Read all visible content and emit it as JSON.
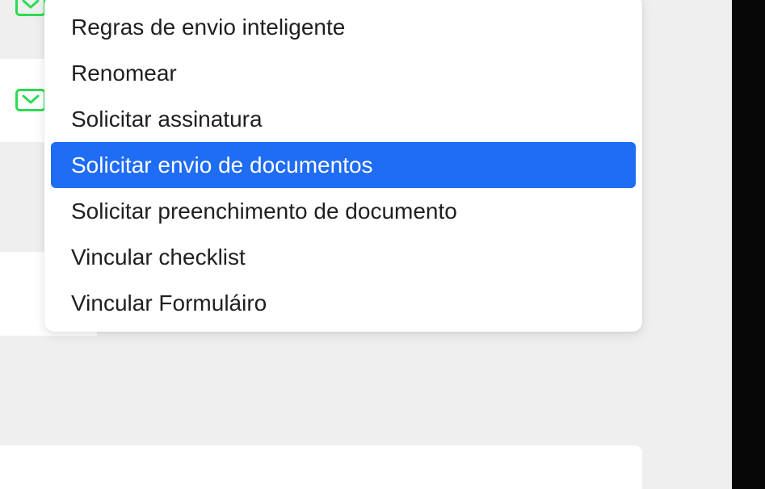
{
  "theme": {
    "selected_color": "#1f6cf5",
    "icon_color": "#2bdc52",
    "background_color": "#efefef",
    "edge_color": "#070707"
  },
  "background": {
    "icons": [
      "mail-icon",
      "mail-icon"
    ]
  },
  "menu": {
    "items": [
      {
        "label": "Regras de envio inteligente",
        "selected": false
      },
      {
        "label": "Renomear",
        "selected": false
      },
      {
        "label": "Solicitar assinatura",
        "selected": false
      },
      {
        "label": "Solicitar envio de documentos",
        "selected": true
      },
      {
        "label": "Solicitar preenchimento de documento",
        "selected": false
      },
      {
        "label": "Vincular checklist",
        "selected": false
      },
      {
        "label": "Vincular Formuláiro",
        "selected": false
      }
    ]
  }
}
